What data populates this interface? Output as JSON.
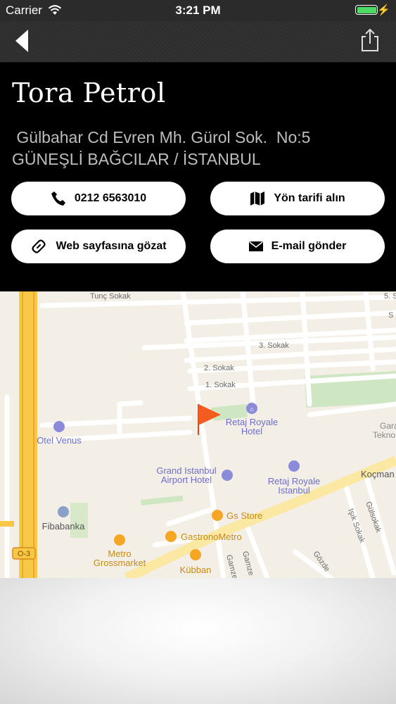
{
  "status_bar": {
    "carrier": "Carrier",
    "time": "3:21 PM"
  },
  "place": {
    "name": "Tora Petrol",
    "address_line1": " Gülbahar Cd Evren Mh. Gürol Sok.  No:5",
    "address_line2": "GÜNEŞLİ BAĞCILAR / İSTANBUL"
  },
  "actions": {
    "phone": "0212 6563010",
    "directions": "Yön tarifi alın",
    "website": "Web sayfasına gözat",
    "email": "E-mail gönder"
  },
  "map": {
    "streets": [
      "Tunç Sokak",
      "3. Sokak",
      "2. Sokak",
      "1. Sokak",
      "Koçman",
      "Gülsokak",
      "Işık Sokak",
      "Gamze",
      "Gamze",
      "Gözde",
      "5. S",
      "S"
    ],
    "pois": [
      "Retaj Royale",
      "Hotel",
      "Otel Venus",
      "Grand Istanbul",
      "Airport Hotel",
      "Retaj Royale",
      "Istanbul",
      "Gs Store",
      "GastronoMetro",
      "Fibabanka",
      "Metro",
      "Grossmarket",
      "Kübban",
      "Gara",
      "Tekno"
    ],
    "road_badge": "O-3"
  },
  "colors": {
    "background": "#000000",
    "button": "#ffffff",
    "pin": "#f25c1e",
    "battery": "#4cd964"
  }
}
